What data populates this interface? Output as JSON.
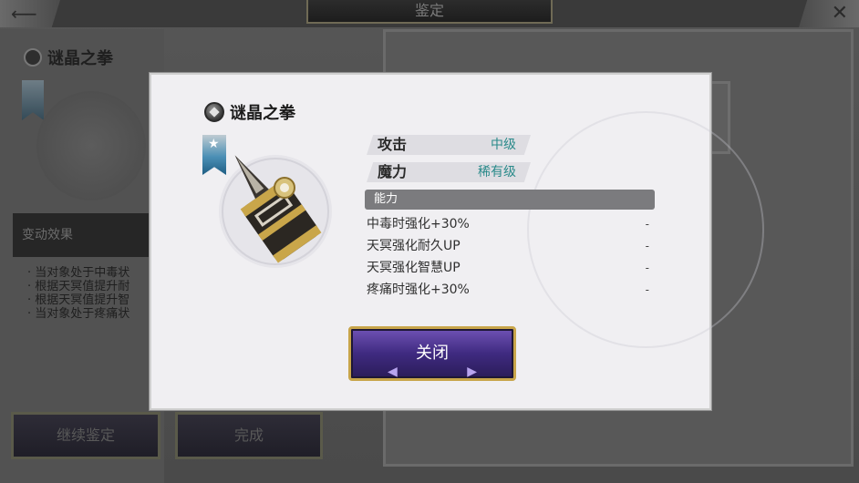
{
  "screen_title": "鉴定",
  "background": {
    "item_name": "谜晶之拳",
    "effect_label": "变动效果",
    "effects": [
      "· 当对象处于中毒状",
      "· 根据天冥值提升耐",
      "· 根据天冥值提升智",
      "· 当对象处于疼痛状"
    ],
    "continue_label": "继续鉴定",
    "done_label": "完成"
  },
  "modal": {
    "item_name": "谜晶之拳",
    "stats": [
      {
        "label": "攻击",
        "value": "中级"
      },
      {
        "label": "魔力",
        "value": "稀有级"
      }
    ],
    "ability_header": "能力",
    "abilities": [
      {
        "name": "中毒时强化+30%",
        "value": "-"
      },
      {
        "name": "天冥强化耐久UP",
        "value": "-"
      },
      {
        "name": "天冥强化智慧UP",
        "value": "-"
      },
      {
        "name": "疼痛时强化+30%",
        "value": "-"
      }
    ],
    "close_label": "关闭"
  },
  "icons": {
    "back": "back-arrow-icon",
    "exit": "close-icon",
    "gem": "gem-icon",
    "rank": "rank-ribbon-icon",
    "item": "fist-weapon-icon"
  },
  "colors": {
    "stat_value": "#2a8a8a",
    "button_fill": "#3f2a80",
    "button_border": "#c8a54a",
    "ribbon_blue": "#1e5d83"
  }
}
